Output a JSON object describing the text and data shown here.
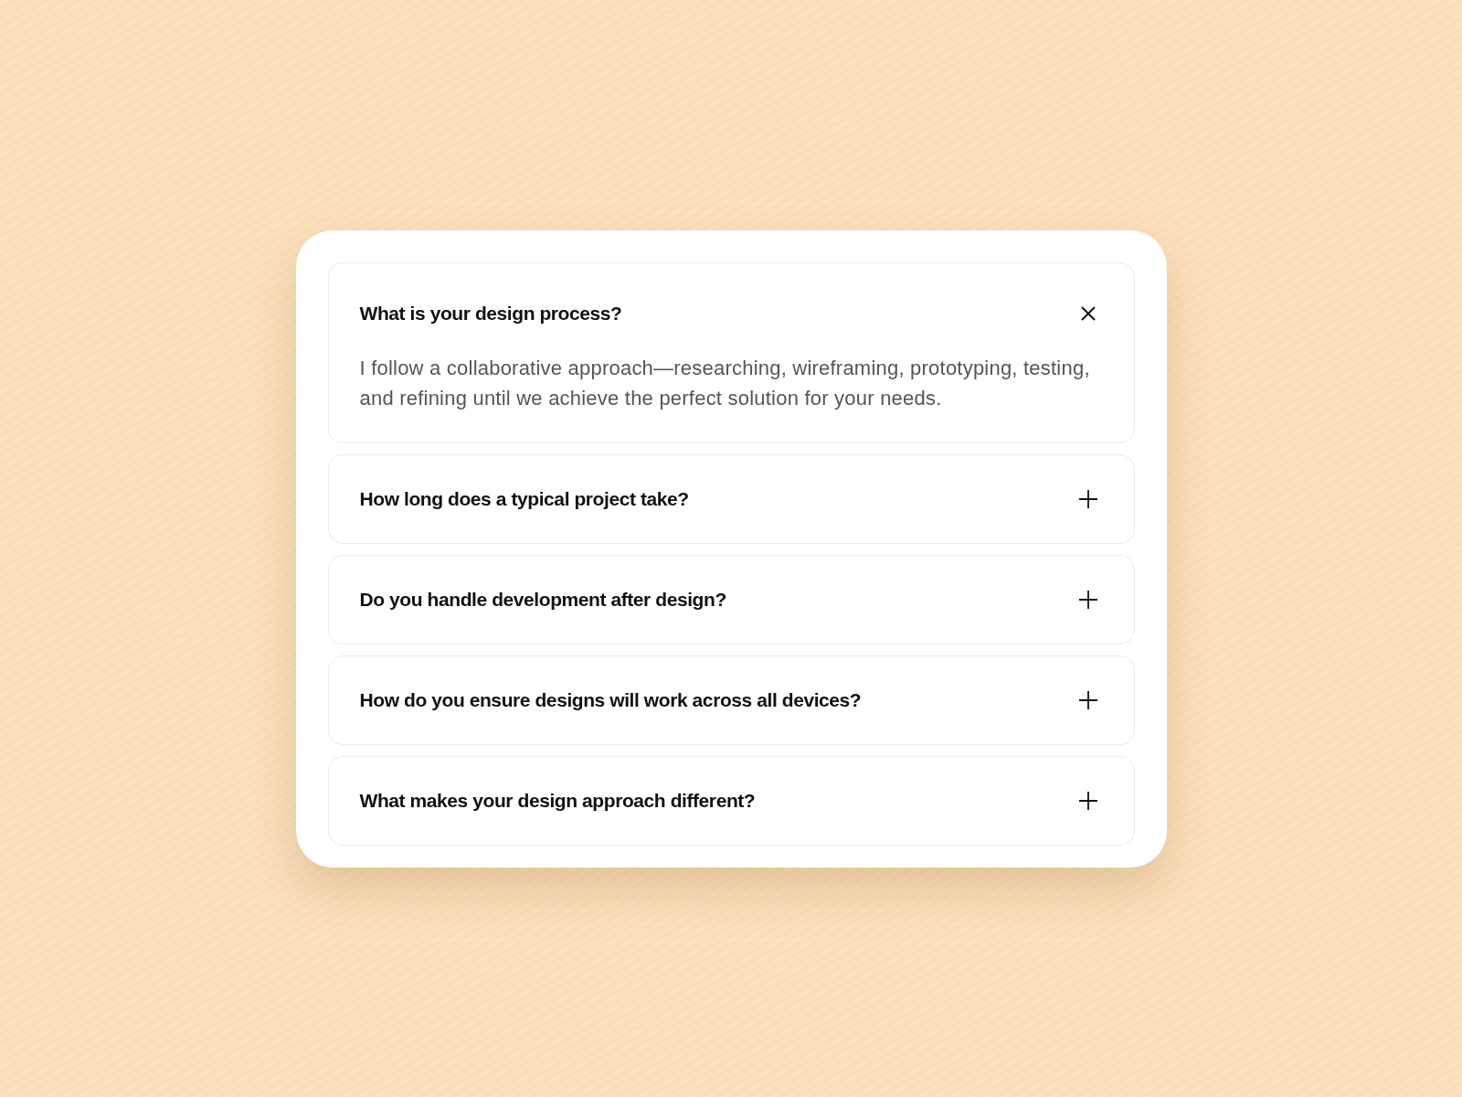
{
  "faq": {
    "items": [
      {
        "question": "What is your design process?",
        "expanded": true,
        "answer": "I follow a collaborative approach—researching, wireframing, prototyping, testing, and refining until we achieve the perfect solution for your needs."
      },
      {
        "question": "How long does a typical project take?",
        "expanded": false
      },
      {
        "question": "Do you handle development after design?",
        "expanded": false
      },
      {
        "question": "How do you ensure designs will work across all devices?",
        "expanded": false
      },
      {
        "question": "What makes your design approach different?",
        "expanded": false
      }
    ]
  }
}
